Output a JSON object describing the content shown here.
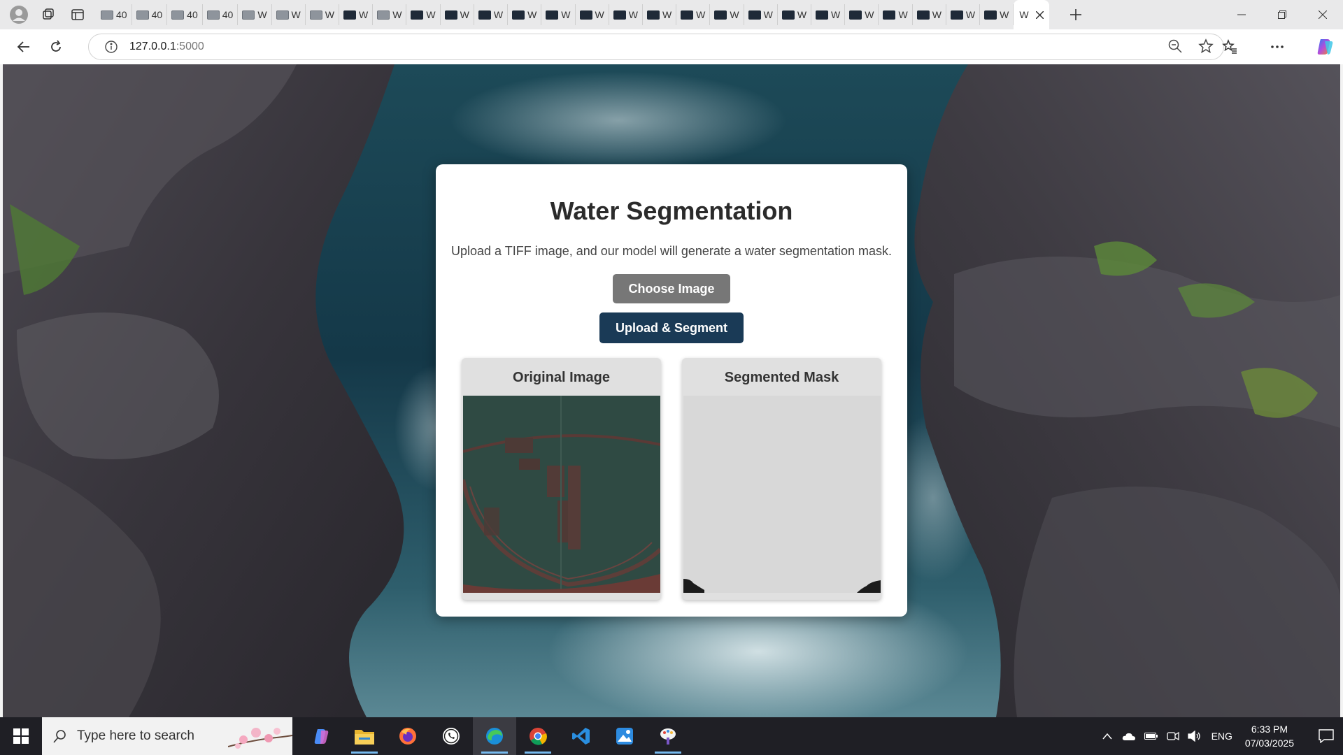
{
  "browser": {
    "tabs": [
      {
        "label": "40",
        "favicon": "gray"
      },
      {
        "label": "40",
        "favicon": "gray"
      },
      {
        "label": "40",
        "favicon": "gray"
      },
      {
        "label": "40",
        "favicon": "gray"
      },
      {
        "label": "W",
        "favicon": "gray"
      },
      {
        "label": "W",
        "favicon": "gray"
      },
      {
        "label": "W",
        "favicon": "gray"
      },
      {
        "label": "W",
        "favicon": "dark"
      },
      {
        "label": "W",
        "favicon": "gray"
      },
      {
        "label": "W",
        "favicon": "dark"
      },
      {
        "label": "W",
        "favicon": "dark"
      },
      {
        "label": "W",
        "favicon": "dark"
      },
      {
        "label": "W",
        "favicon": "dark"
      },
      {
        "label": "W",
        "favicon": "dark"
      },
      {
        "label": "W",
        "favicon": "dark"
      },
      {
        "label": "W",
        "favicon": "dark"
      },
      {
        "label": "W",
        "favicon": "dark"
      },
      {
        "label": "W",
        "favicon": "dark"
      },
      {
        "label": "W",
        "favicon": "dark"
      },
      {
        "label": "W",
        "favicon": "dark"
      },
      {
        "label": "W",
        "favicon": "dark"
      },
      {
        "label": "W",
        "favicon": "dark"
      },
      {
        "label": "W",
        "favicon": "dark"
      },
      {
        "label": "W",
        "favicon": "dark"
      },
      {
        "label": "W",
        "favicon": "dark"
      },
      {
        "label": "W",
        "favicon": "dark"
      },
      {
        "label": "W",
        "favicon": "dark"
      }
    ],
    "active_tab": {
      "label": "W"
    },
    "address": {
      "host": "127.0.0.1",
      "port": ":5000"
    }
  },
  "page": {
    "title": "Water Segmentation",
    "description": "Upload a TIFF image, and our model will generate a water segmentation mask.",
    "choose_label": "Choose Image",
    "upload_label": "Upload & Segment",
    "panels": {
      "original_title": "Original Image",
      "mask_title": "Segmented Mask"
    }
  },
  "taskbar": {
    "search_placeholder": "Type here to search",
    "language": "ENG",
    "time": "6:33 PM",
    "date": "07/03/2025",
    "apps": [
      "copilot-icon",
      "file-explorer-icon",
      "firefox-icon",
      "whatsapp-icon",
      "edge-icon",
      "chrome-icon",
      "vscode-icon",
      "photos-icon",
      "paint-icon"
    ]
  },
  "colors": {
    "primary_button": "#1a3a56",
    "secondary_button": "#777777",
    "card_background": "#ffffff",
    "mask_background": "#d8d8d8"
  }
}
